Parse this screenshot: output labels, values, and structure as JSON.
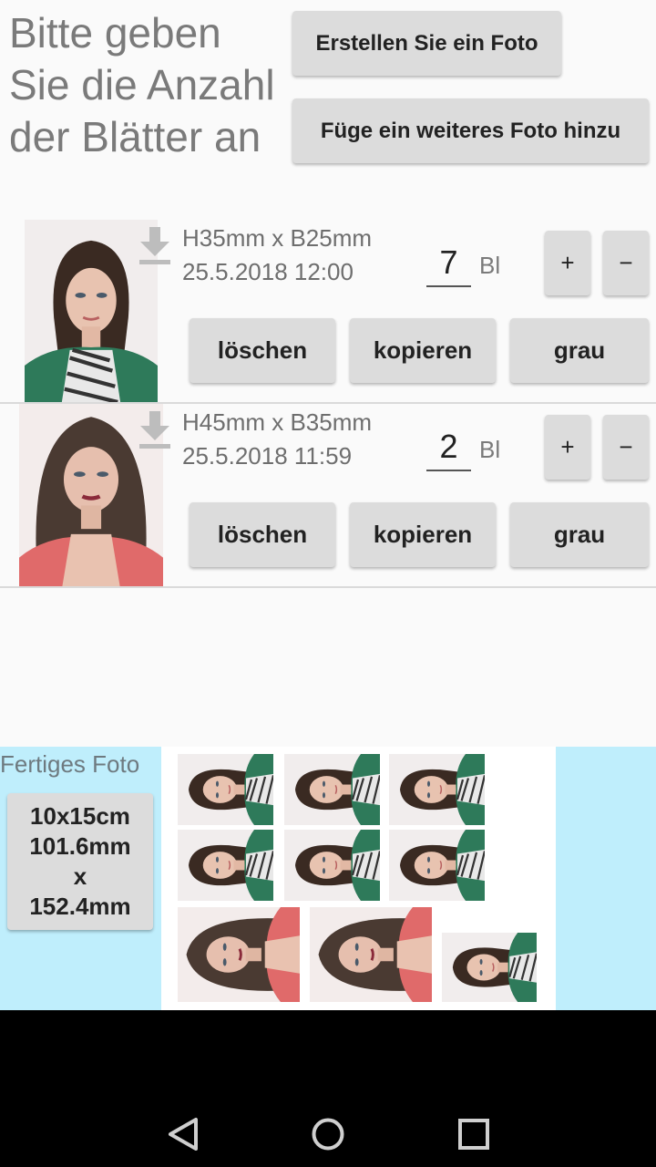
{
  "header": {
    "prompt": "Bitte geben Sie die Anzahl der Blätter an",
    "create_photo_button": "Erstellen Sie ein Foto",
    "add_photo_button": "Füge ein weiteres Foto hinzu"
  },
  "photos": [
    {
      "size": "H35mm x B25mm",
      "date": "25.5.2018 12:00",
      "count": "7",
      "unit": "Bl",
      "plus": "+",
      "minus": "−",
      "delete": "löschen",
      "copy": "kopieren",
      "gray": "grau"
    },
    {
      "size": "H45mm x B35mm",
      "date": "25.5.2018 11:59",
      "count": "2",
      "unit": "Bl",
      "plus": "+",
      "minus": "−",
      "delete": "löschen",
      "copy": "kopieren",
      "gray": "grau"
    }
  ],
  "finished": {
    "label": "Fertiges Foto",
    "format_line1": "10x15cm",
    "format_line2": "101.6mm",
    "format_line3": "x",
    "format_line4": "152.4mm"
  },
  "icons": {
    "download": "download-icon",
    "nav_back": "back-triangle-icon",
    "nav_home": "home-circle-icon",
    "nav_recents": "recents-square-icon"
  },
  "colors": {
    "bottom_panel": "#bfeefc",
    "button": "#dcdcdc",
    "nav_bar": "#000000"
  }
}
